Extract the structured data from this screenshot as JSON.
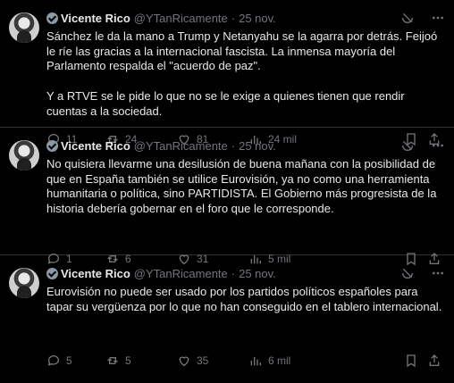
{
  "tweets": [
    {
      "name": "Vicente Rico",
      "handle": "@YTanRicamente",
      "dot": "·",
      "date": "25 nov.",
      "text": "Sánchez le da la mano a Trump y Netanyahu se la agarra por detrás. Feijoó le ríe las gracias a la internacional fascista. La inmensa mayoría del Parlamento respalda el \"acuerdo de paz\".\n\nY a RTVE se le pide lo que no se le exige a quienes tienen que rendir cuentas a la sociedad.",
      "replies": "11",
      "retweets": "24",
      "likes": "81",
      "views": "24 mil"
    },
    {
      "name": "Vicente Rico",
      "handle": "@YTanRicamente",
      "dot": "·",
      "date": "25 nov.",
      "text": "No quisiera llevarme una desilusión de buena mañana con la posibilidad de que en España también se utilice Eurovisión, ya no como una herramienta humanitaria o política, sino PARTIDISTA. El Gobierno más progresista de la historia debería gobernar en el foro que le corresponde.",
      "replies": "1",
      "retweets": "6",
      "likes": "31",
      "views": "5 mil"
    },
    {
      "name": "Vicente Rico",
      "handle": "@YTanRicamente",
      "dot": "·",
      "date": "25 nov.",
      "text": "Eurovisión no puede ser usado por los partidos políticos españoles para tapar su vergüenza por lo que no han conseguido en el tablero internacional.",
      "replies": "5",
      "retweets": "5",
      "likes": "35",
      "views": "6 mil"
    }
  ],
  "icons": {
    "verified": "verified-badge-icon",
    "grok": "grok-icon",
    "more": "more-options-icon",
    "reply": "reply-icon",
    "retweet": "retweet-icon",
    "like": "like-icon",
    "views": "views-icon",
    "bookmark": "bookmark-icon",
    "share": "share-icon"
  },
  "colors": {
    "background": "#000000",
    "text": "#e7e9ea",
    "muted": "#71767b",
    "divider": "#2f3336"
  }
}
